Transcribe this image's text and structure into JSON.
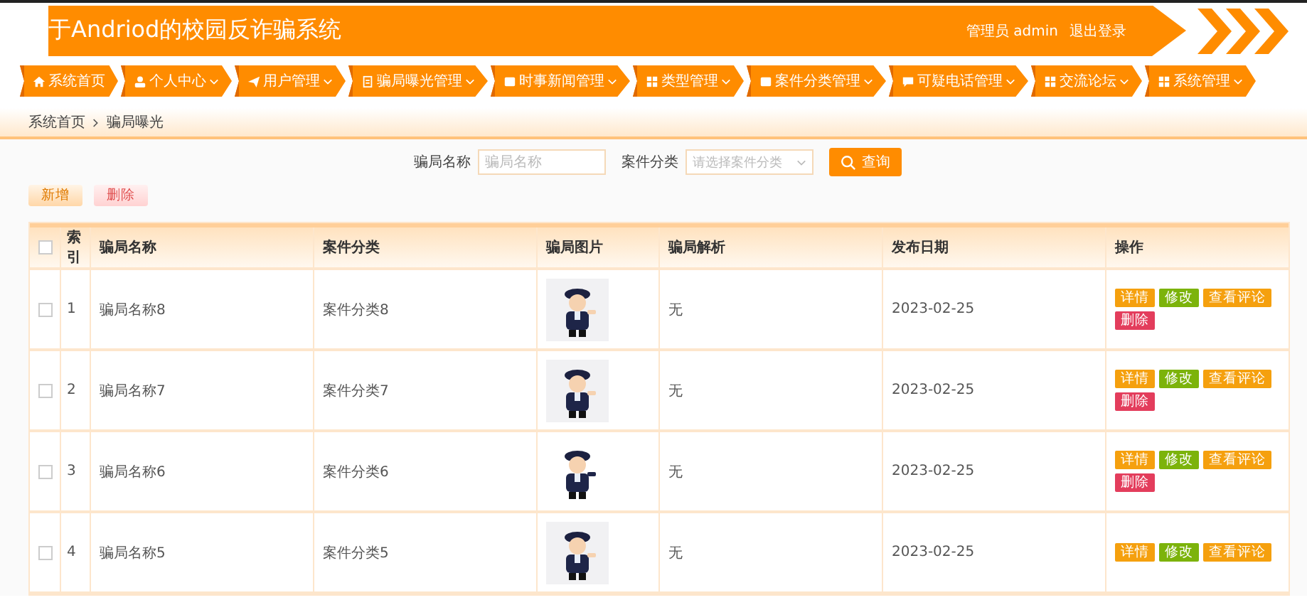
{
  "header": {
    "title": "于Andriod的校园反诈骗系统",
    "user": "管理员 admin",
    "logout": "退出登录"
  },
  "nav": [
    {
      "label": "系统首页",
      "has_menu": false
    },
    {
      "label": "个人中心",
      "has_menu": true
    },
    {
      "label": "用户管理",
      "has_menu": true
    },
    {
      "label": "骗局曝光管理",
      "has_menu": true
    },
    {
      "label": "时事新闻管理",
      "has_menu": true
    },
    {
      "label": "类型管理",
      "has_menu": true
    },
    {
      "label": "案件分类管理",
      "has_menu": true
    },
    {
      "label": "可疑电话管理",
      "has_menu": true
    },
    {
      "label": "交流论坛",
      "has_menu": true
    },
    {
      "label": "系统管理",
      "has_menu": true
    }
  ],
  "breadcrumb": [
    "系统首页",
    "骗局曝光"
  ],
  "search": {
    "name_label": "骗局名称",
    "name_placeholder": "骗局名称",
    "category_label": "案件分类",
    "category_placeholder": "请选择案件分类",
    "button": "查询"
  },
  "toolbar": [
    {
      "label": "新增",
      "kind": "add"
    },
    {
      "label": "删除",
      "kind": "delete"
    }
  ],
  "table": {
    "select_all_checked": false,
    "columns": [
      "索引",
      "骗局名称",
      "案件分类",
      "骗局图片",
      "骗局解析",
      "发布日期",
      "操作"
    ],
    "rows": [
      {
        "checked": false,
        "index": "1",
        "name": "骗局名称8",
        "category": "案件分类8",
        "analysis": "无",
        "date": "2023-02-25",
        "actions": [
          {
            "label": "详情",
            "kind": "detail"
          },
          {
            "label": "修改",
            "kind": "edit"
          },
          {
            "label": "查看评论",
            "kind": "comments"
          },
          {
            "label": "删除",
            "kind": "delete"
          }
        ]
      },
      {
        "checked": false,
        "index": "2",
        "name": "骗局名称7",
        "category": "案件分类7",
        "analysis": "无",
        "date": "2023-02-25",
        "actions": [
          {
            "label": "详情",
            "kind": "detail"
          },
          {
            "label": "修改",
            "kind": "edit"
          },
          {
            "label": "查看评论",
            "kind": "comments"
          },
          {
            "label": "删除",
            "kind": "delete"
          }
        ]
      },
      {
        "checked": false,
        "index": "3",
        "name": "骗局名称6",
        "category": "案件分类6",
        "analysis": "无",
        "date": "2023-02-25",
        "actions": [
          {
            "label": "详情",
            "kind": "detail"
          },
          {
            "label": "修改",
            "kind": "edit"
          },
          {
            "label": "查看评论",
            "kind": "comments"
          },
          {
            "label": "删除",
            "kind": "delete"
          }
        ]
      },
      {
        "checked": false,
        "index": "4",
        "name": "骗局名称5",
        "category": "案件分类5",
        "analysis": "无",
        "date": "2023-02-25",
        "actions": [
          {
            "label": "详情",
            "kind": "detail"
          },
          {
            "label": "修改",
            "kind": "edit"
          },
          {
            "label": "查看评论",
            "kind": "comments"
          }
        ]
      }
    ]
  }
}
